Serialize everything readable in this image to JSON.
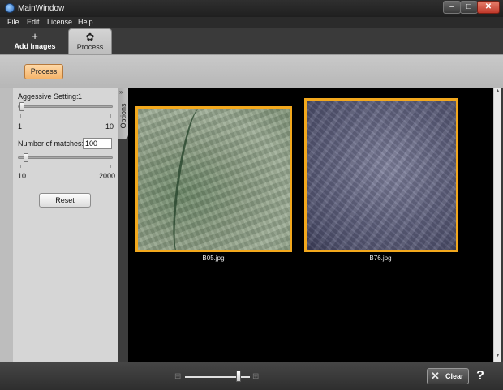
{
  "window": {
    "title": "MainWindow",
    "min_glyph": "–",
    "max_glyph": "□",
    "close_glyph": "✕"
  },
  "menu": {
    "items": [
      "File",
      "Edit",
      "License",
      "Help"
    ]
  },
  "ribbon": {
    "tabs": [
      {
        "label": "Add Images",
        "icon": "plus-icon",
        "glyph": "+"
      },
      {
        "label": "Process",
        "icon": "gear-icon",
        "glyph": "✿",
        "active": true
      }
    ]
  },
  "toolbar": {
    "process_label": "Process"
  },
  "options": {
    "tab_label": "Options",
    "tab_chevron": "»",
    "aggressive_label": "Aggessive Setting:",
    "aggressive_value": "1",
    "aggressive_min": "1",
    "aggressive_max": "10",
    "aggressive_level": 0,
    "matches_label": "Number of matches:",
    "matches_value": "100",
    "matches_min": "10",
    "matches_max": "2000",
    "matches_level": 0.05,
    "reset_label": "Reset"
  },
  "images": [
    {
      "caption": "B05.jpg",
      "selected": true
    },
    {
      "caption": "B76.jpg",
      "selected": true
    }
  ],
  "bottom": {
    "zoom_minus": "⊟",
    "zoom_plus": "⊞",
    "zoom_level": 0.85,
    "clear_label": "Clear",
    "clear_glyph": "✕",
    "help_glyph": "?"
  },
  "scroll": {
    "up_glyph": "▲",
    "down_glyph": "▼"
  },
  "colors": {
    "selection_border": "#f2a81d",
    "process_button": "#f5b46a",
    "viewer_bg": "#000000"
  }
}
